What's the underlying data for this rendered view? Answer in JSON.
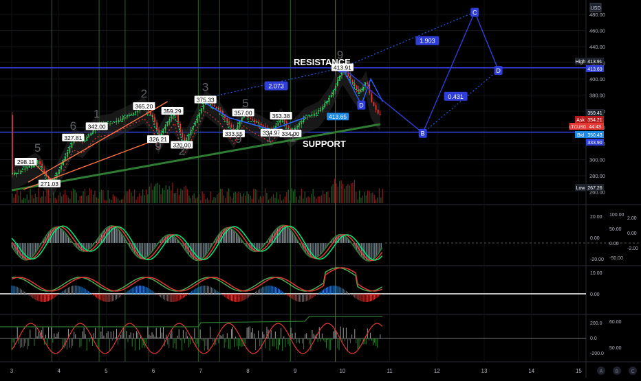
{
  "chart": {
    "currency": "USD",
    "symbol": "LTCUSD",
    "price_scale": [
      "480.00",
      "460.00",
      "440.00",
      "420.00",
      "400.00",
      "380.00",
      "360.00",
      "340.00",
      "320.00",
      "300.00",
      "280.00",
      "260.00"
    ],
    "price_scale_values": [
      480,
      460,
      440,
      420,
      400,
      380,
      360,
      340,
      320,
      300,
      280,
      260
    ],
    "x_axis": [
      "3",
      "4",
      "5",
      "6",
      "7",
      "8",
      "9",
      "10",
      "11",
      "12",
      "13",
      "14",
      "15"
    ],
    "x_axis_slots": [
      3,
      4,
      5,
      6,
      7,
      8,
      9,
      10,
      11,
      12,
      13,
      14,
      15
    ],
    "axis_icons": [
      "A",
      "B",
      "C"
    ],
    "price_labels": {
      "high_label": "High",
      "high_value": "413.91",
      "high2_value": "413.69",
      "p359": "359.41",
      "ask_label": "Ask",
      "ask_value": "354.21",
      "ltc_value": "44:43",
      "bid_label": "Bid",
      "bid_value": "350.43",
      "support_value": "333.90",
      "low_label": "Low",
      "low_value": "267.26"
    },
    "annotations": {
      "resistance": "RESISTANCE",
      "support": "SUPPORT"
    },
    "fib": {
      "r1": "2.073",
      "r2": "1.903",
      "r3": "0.431",
      "A": "A",
      "B": "B",
      "C": "C",
      "D1": "D",
      "D2": "D"
    },
    "wave_counts": {
      "c5": "5",
      "c6": "6",
      "c1": "1",
      "c2": "2",
      "c3": "3",
      "c5b": "5",
      "c9a": "9",
      "c2b": "2",
      "c9b": "9",
      "c1b": "1",
      "c1c": "1",
      "c9c": "9"
    },
    "price_tags": [
      {
        "text": "298.11",
        "slot": 3.3,
        "price": 297
      },
      {
        "text": "271.03",
        "slot": 3.8,
        "price": 270
      },
      {
        "text": "327.81",
        "slot": 4.3,
        "price": 327
      },
      {
        "text": "342.00",
        "slot": 4.8,
        "price": 341
      },
      {
        "text": "365.20",
        "slot": 5.8,
        "price": 366
      },
      {
        "text": "326.21",
        "slot": 6.1,
        "price": 325
      },
      {
        "text": "359.29",
        "slot": 6.4,
        "price": 360
      },
      {
        "text": "320.00",
        "slot": 6.6,
        "price": 318
      },
      {
        "text": "375.33",
        "slot": 7.1,
        "price": 374
      },
      {
        "text": "333.55",
        "slot": 7.7,
        "price": 332
      },
      {
        "text": "357.00",
        "slot": 7.9,
        "price": 358
      },
      {
        "text": "334.97",
        "slot": 8.5,
        "price": 333
      },
      {
        "text": "353.38",
        "slot": 8.7,
        "price": 354
      },
      {
        "text": "334.00",
        "slot": 8.9,
        "price": 332
      },
      {
        "text": "413.91",
        "slot": 10.0,
        "price": 414
      },
      {
        "text": "413.65",
        "slot": 9.9,
        "price": 353
      }
    ],
    "osc1_scale": {
      "left": [
        "20.00",
        "0.00",
        "-20.00"
      ],
      "right": [
        "100.00",
        "50.00",
        "0.00",
        "-50.00"
      ],
      "far": [
        "2.00",
        "0.00",
        "-2.00"
      ]
    },
    "osc2_scale": {
      "left": [
        "10.00",
        "0.00"
      ]
    },
    "osc3_scale": {
      "left": [
        "200.0",
        "0.0",
        "-200.0"
      ],
      "right": [
        "60.00",
        "50.00"
      ]
    }
  }
}
